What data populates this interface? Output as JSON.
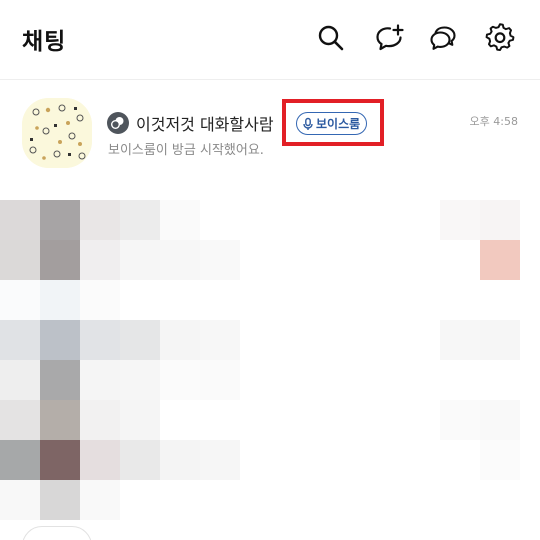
{
  "header": {
    "title": "채팅",
    "icons": {
      "search": "search-icon",
      "new_chat": "new-chat-icon",
      "open_chat": "open-chat-icon",
      "settings": "gear-icon"
    }
  },
  "chat": {
    "room_name": "이것저것 대화할사람",
    "badge_label": "보이스룸",
    "time": "오후 4:58",
    "preview": "보이스룸이 방금 시작했어요.",
    "colors": {
      "highlight": "#e21f26",
      "badge": "#2c5aa0"
    }
  },
  "mosaic_colors": [
    [
      "#dcd9d9",
      "#a7a4a5",
      "#e9e6e6",
      "#ececec",
      "#fafafa",
      "#ffffff",
      "#ffffff",
      "#ffffff",
      "#ffffff",
      "#ffffff",
      "#ffffff",
      "#f9f7f7",
      "#f7f4f4",
      "#ffffff"
    ],
    [
      "#dbd9d8",
      "#a39e9e",
      "#f0eeef",
      "#f6f6f6",
      "#f7f7f7",
      "#f9f9f9",
      "#ffffff",
      "#ffffff",
      "#ffffff",
      "#ffffff",
      "#ffffff",
      "#ffffff",
      "#f2c9bf",
      "#ffffff"
    ],
    [
      "#fafbfc",
      "#f1f4f7",
      "#fbfbfb",
      "#ffffff",
      "#ffffff",
      "#ffffff",
      "#ffffff",
      "#ffffff",
      "#ffffff",
      "#ffffff",
      "#ffffff",
      "#ffffff",
      "#ffffff",
      "#ffffff"
    ],
    [
      "#e0e2e5",
      "#bcc1c8",
      "#e1e3e6",
      "#e5e6e7",
      "#f5f5f5",
      "#f7f7f7",
      "#ffffff",
      "#ffffff",
      "#ffffff",
      "#ffffff",
      "#ffffff",
      "#f7f7f7",
      "#f6f6f6",
      "#ffffff"
    ],
    [
      "#eeeeee",
      "#a9a9aa",
      "#f5f5f5",
      "#f6f6f6",
      "#fbfbfb",
      "#fafafa",
      "#ffffff",
      "#ffffff",
      "#ffffff",
      "#ffffff",
      "#ffffff",
      "#ffffff",
      "#ffffff",
      "#ffffff"
    ],
    [
      "#e4e3e3",
      "#b4aea9",
      "#f2f1f1",
      "#f5f5f5",
      "#ffffff",
      "#ffffff",
      "#ffffff",
      "#ffffff",
      "#ffffff",
      "#ffffff",
      "#ffffff",
      "#fafafa",
      "#f9f9f9",
      "#ffffff"
    ],
    [
      "#a6a8a9",
      "#7e6565",
      "#e5dedf",
      "#e9e9e9",
      "#f4f4f4",
      "#f6f6f6",
      "#ffffff",
      "#ffffff",
      "#ffffff",
      "#ffffff",
      "#ffffff",
      "#ffffff",
      "#fbfbfb",
      "#ffffff"
    ],
    [
      "#f8f8f8",
      "#d8d7d7",
      "#f9f9f9",
      "#ffffff",
      "#ffffff",
      "#ffffff",
      "#ffffff",
      "#ffffff",
      "#ffffff",
      "#ffffff",
      "#ffffff",
      "#ffffff",
      "#ffffff",
      "#ffffff"
    ]
  ]
}
